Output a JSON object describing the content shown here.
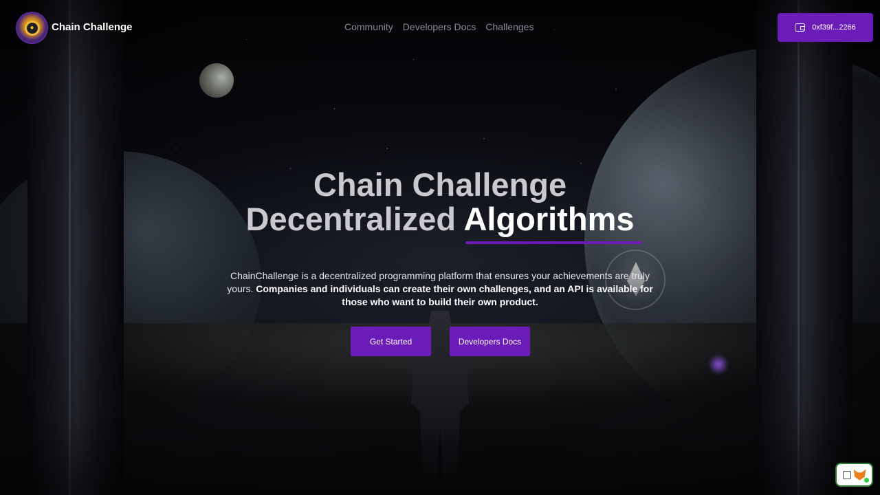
{
  "header": {
    "brand": "Chain Challenge",
    "nav": [
      "Community",
      "Developers Docs",
      "Challenges"
    ],
    "wallet_address": "0xf39f...2266"
  },
  "hero": {
    "title_line1": "Chain Challenge",
    "title_line2_plain": "Decentralized ",
    "title_line2_accent": "Algorithms",
    "description_plain": "ChainChallenge is a decentralized programming platform that ensures your achievements are truly yours. ",
    "description_bold": "Companies and individuals can create their own challenges, and an API is available for those who want to build their own product.",
    "buttons": {
      "get_started": "Get Started",
      "developers_docs": "Developers Docs"
    }
  },
  "colors": {
    "accent": "#6b1bb8",
    "background": "#07060c",
    "nav_text": "#8a8a98"
  },
  "icons": {
    "logo": "chain-challenge-logo-icon",
    "wallet": "wallet-icon",
    "metamask": "metamask-fox-icon"
  }
}
